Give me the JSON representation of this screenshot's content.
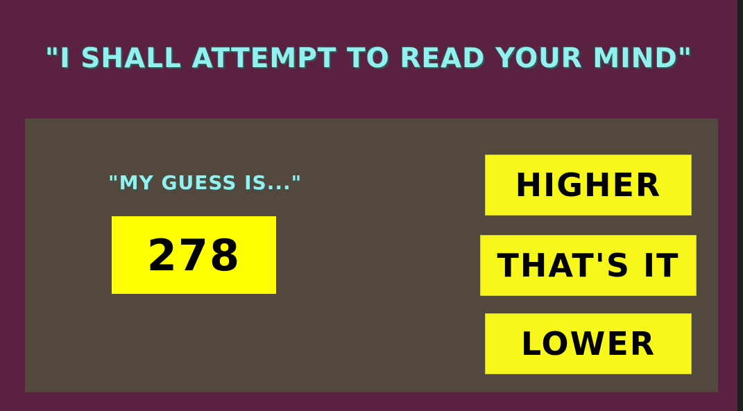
{
  "title": "\"I SHALL ATTEMPT TO READ YOUR MIND\"",
  "guess": {
    "label": "\"MY GUESS IS...\"",
    "value": "278"
  },
  "buttons": {
    "higher": "HIGHER",
    "thats_it": "THAT'S IT",
    "lower": "LOWER"
  },
  "colors": {
    "background": "#5b2140",
    "panel": "#52483e",
    "title_text": "#93f0ee",
    "button": "#f7f71c",
    "guess_box": "#ffff00"
  }
}
